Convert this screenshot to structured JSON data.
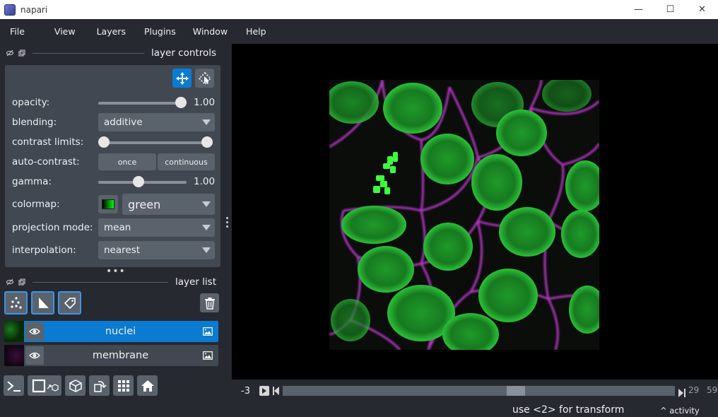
{
  "window": {
    "title": "napari",
    "minimize": "—",
    "maximize": "☐",
    "close": "✕"
  },
  "menu": [
    "File",
    "View",
    "Layers",
    "Plugins",
    "Window",
    "Help"
  ],
  "layer_controls": {
    "title": "layer controls",
    "opacity": {
      "label": "opacity:",
      "value": "1.00",
      "fraction": 1.0
    },
    "blending": {
      "label": "blending:",
      "value": "additive"
    },
    "contrast_limits": {
      "label": "contrast limits:",
      "low_fraction": 0.0,
      "high_fraction": 1.0
    },
    "auto_contrast": {
      "label": "auto-contrast:",
      "once": "once",
      "continuous": "continuous"
    },
    "gamma": {
      "label": "gamma:",
      "value": "1.00",
      "fraction": 0.45
    },
    "colormap": {
      "label": "colormap:",
      "value": "green"
    },
    "projection_mode": {
      "label": "projection mode:",
      "value": "mean"
    },
    "interpolation": {
      "label": "interpolation:",
      "value": "nearest"
    }
  },
  "layer_list": {
    "title": "layer list",
    "layers": [
      {
        "name": "nuclei",
        "selected": true
      },
      {
        "name": "membrane",
        "selected": false
      }
    ]
  },
  "dims": {
    "value": "-3",
    "current": "29",
    "total": "59",
    "fraction": 0.6
  },
  "status": {
    "message": "use <2> for transform",
    "activity": "^ activity"
  },
  "colors": {
    "accent": "#0a7bd1",
    "panel": "#414851",
    "background": "#262930",
    "widget": "#5a626c"
  }
}
